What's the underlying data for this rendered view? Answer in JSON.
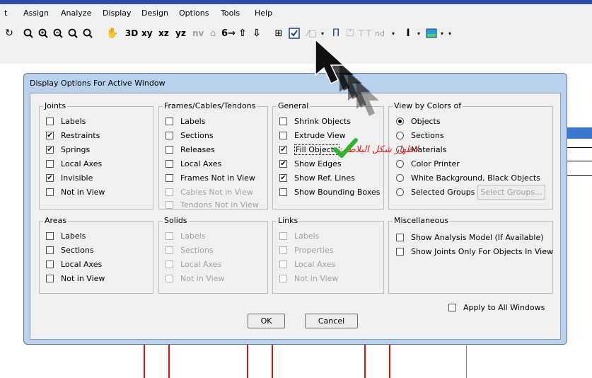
{
  "menubar": {
    "items": [
      "t",
      "Assign",
      "Analyze",
      "Display",
      "Design",
      "Options",
      "Tools",
      "Help"
    ]
  },
  "toolbar": {
    "labels": {
      "xy": "xy",
      "xz": "xz",
      "yz": "yz",
      "nv": "nv",
      "nd": "nd"
    }
  },
  "dialog": {
    "title": "Display Options For Active Window",
    "joints": {
      "title": "Joints",
      "options": [
        {
          "label": "Labels",
          "checked": false
        },
        {
          "label": "Restraints",
          "checked": true
        },
        {
          "label": "Springs",
          "checked": true
        },
        {
          "label": "Local Axes",
          "checked": false
        },
        {
          "label": "Invisible",
          "checked": true
        },
        {
          "label": "Not in View",
          "checked": false
        }
      ]
    },
    "frames": {
      "title": "Frames/Cables/Tendons",
      "options": [
        {
          "label": "Labels",
          "checked": false
        },
        {
          "label": "Sections",
          "checked": false
        },
        {
          "label": "Releases",
          "checked": false
        },
        {
          "label": "Local Axes",
          "checked": false
        },
        {
          "label": "Frames Not in View",
          "checked": false
        },
        {
          "label": "Cables Not in View",
          "checked": false,
          "disabled": true
        },
        {
          "label": "Tendons Not in View",
          "checked": false,
          "disabled": true
        }
      ]
    },
    "general": {
      "title": "General",
      "options": [
        {
          "label": "Shrink Objects",
          "checked": false
        },
        {
          "label": "Extrude View",
          "checked": false
        },
        {
          "label": "Fill Objects",
          "checked": true
        },
        {
          "label": "Show Edges",
          "checked": true
        },
        {
          "label": "Show Ref. Lines",
          "checked": true
        },
        {
          "label": "Show Bounding Boxes",
          "checked": false
        }
      ]
    },
    "view_by_colors": {
      "title": "View by Colors of",
      "options": [
        {
          "label": "Objects",
          "selected": true
        },
        {
          "label": "Sections",
          "selected": false
        },
        {
          "label": "Materials",
          "selected": false
        },
        {
          "label": "Color Printer",
          "selected": false
        },
        {
          "label": "White Background, Black Objects",
          "selected": false
        },
        {
          "label": "Selected Groups",
          "selected": false
        }
      ],
      "select_groups_button": "Select Groups..."
    },
    "areas": {
      "title": "Areas",
      "options": [
        {
          "label": "Labels",
          "checked": false
        },
        {
          "label": "Sections",
          "checked": false
        },
        {
          "label": "Local Axes",
          "checked": false
        },
        {
          "label": "Not in View",
          "checked": false
        }
      ]
    },
    "solids": {
      "title": "Solids",
      "options": [
        {
          "label": "Labels",
          "checked": false,
          "disabled": true
        },
        {
          "label": "Sections",
          "checked": false,
          "disabled": true
        },
        {
          "label": "Local Axes",
          "checked": false,
          "disabled": true
        },
        {
          "label": "Not in View",
          "checked": false,
          "disabled": true
        }
      ]
    },
    "links": {
      "title": "Links",
      "options": [
        {
          "label": "Labels",
          "checked": false,
          "disabled": true
        },
        {
          "label": "Properties",
          "checked": false,
          "disabled": true
        },
        {
          "label": "Local Axes",
          "checked": false,
          "disabled": true
        },
        {
          "label": "Not in View",
          "checked": false,
          "disabled": true
        }
      ]
    },
    "misc": {
      "title": "Miscellaneous",
      "options": [
        {
          "label": "Show Analysis Model  (If Available)",
          "checked": false
        },
        {
          "label": "Show Joints Only For Objects In View",
          "checked": false
        }
      ]
    },
    "apply_all": {
      "label": "Apply to All Windows",
      "checked": false
    },
    "ok_label": "OK",
    "cancel_label": "Cancel"
  },
  "annotation": {
    "text": "لاظهار شكل البلاطات",
    "color": "#e81e1e",
    "check_color": "#2db52d"
  }
}
